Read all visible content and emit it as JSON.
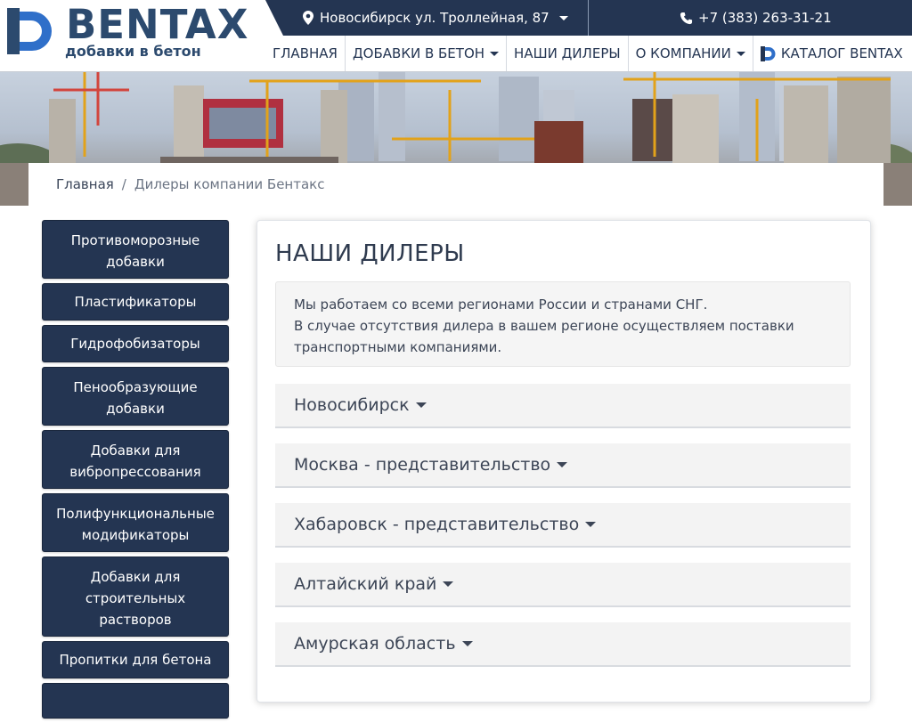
{
  "brand": {
    "name": "BENTAX",
    "tagline": "добавки в бетон",
    "colors": {
      "primary": "#243552",
      "accent": "#2f6fc9"
    }
  },
  "topbar": {
    "address": "Новосибирск ул. Троллейная, 87",
    "address_icon": "map-marker-icon",
    "phone": "+7 (383) 263-31-21",
    "phone_icon": "phone-icon"
  },
  "nav": {
    "items": [
      {
        "label": "ГЛАВНАЯ",
        "dropdown": false
      },
      {
        "label": "ДОБАВКИ В БЕТОН",
        "dropdown": true
      },
      {
        "label": "НАШИ ДИЛЕРЫ",
        "dropdown": false
      },
      {
        "label": "О КОМПАНИИ",
        "dropdown": true
      },
      {
        "label": "КАТАЛОГ BENTAX",
        "dropdown": false
      }
    ]
  },
  "breadcrumb": {
    "home": "Главная",
    "separator": "/",
    "current": "Дилеры компании Бентакс"
  },
  "sidebar": {
    "items": [
      "Противоморозные добавки",
      "Пластификаторы",
      "Гидрофобизаторы",
      "Пенообразующие добавки",
      "Добавки для вибропрессования",
      "Полифункциональные модификаторы",
      "Добавки для строительных растворов",
      "Пропитки для бетона"
    ]
  },
  "main": {
    "title": "НАШИ ДИЛЕРЫ",
    "info_line1": "Мы работаем со всеми регионами России и странами СНГ.",
    "info_line2": "В случае отсутствия дилера в вашем регионе осуществляем поставки транспортными компаниями.",
    "regions": [
      "Новосибирск",
      "Москва - представительство",
      "Хабаровск - представительство",
      "Алтайский край",
      "Амурская область"
    ]
  }
}
